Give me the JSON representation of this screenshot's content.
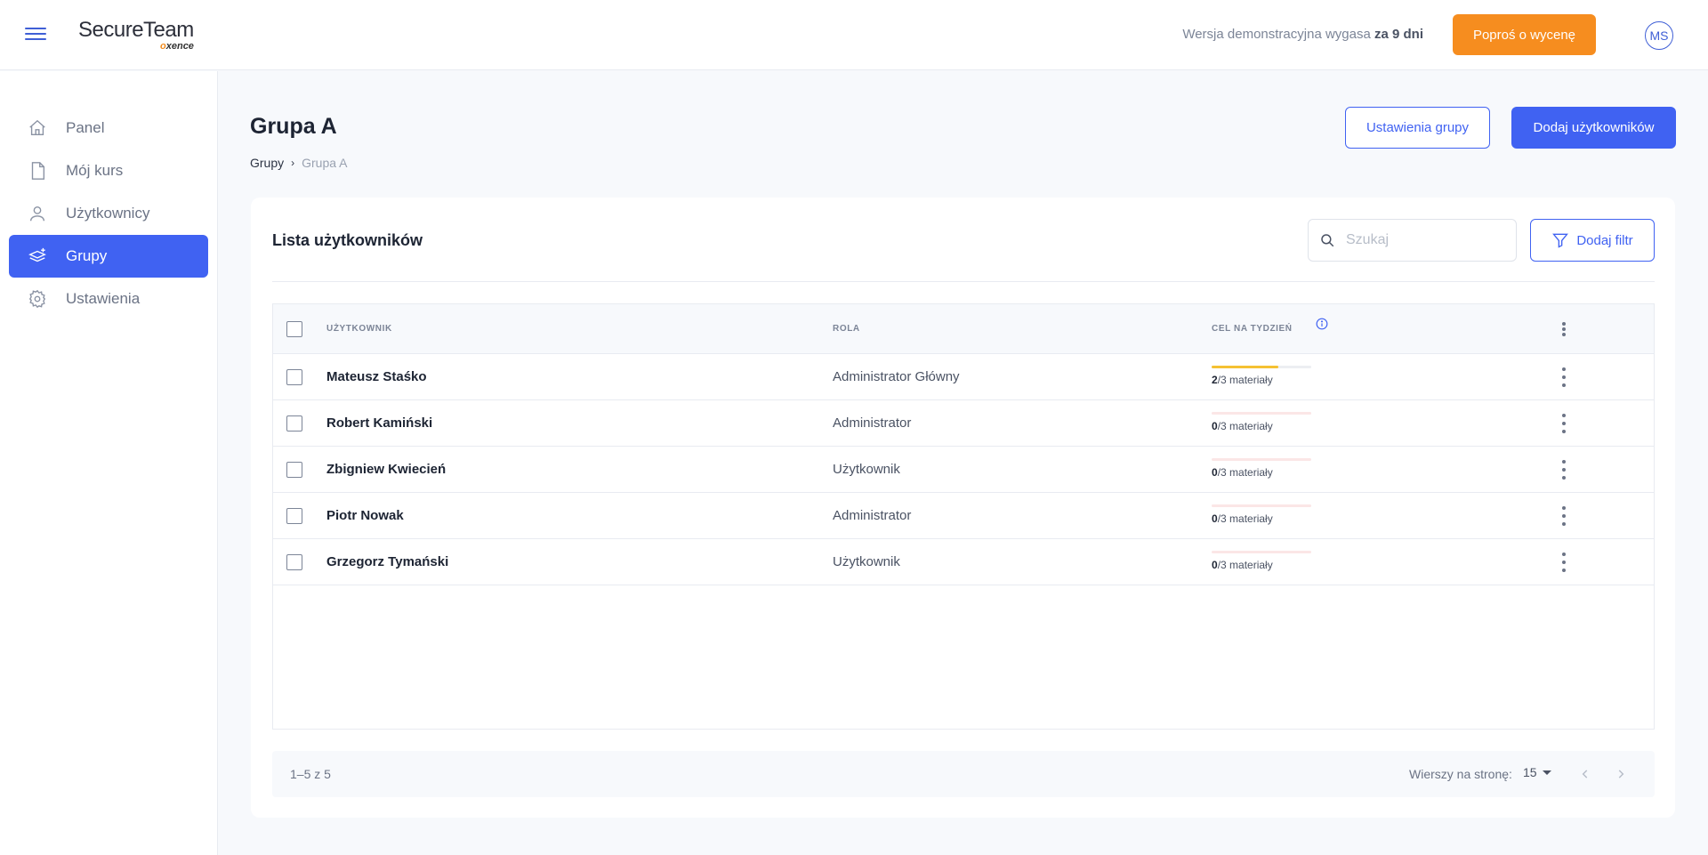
{
  "header": {
    "logo_main": "SecureTeam",
    "logo_sub_prefix": "o",
    "logo_sub_rest": "xence",
    "trial_text": "Wersja demonstracyjna wygasa",
    "trial_bold": "za 9 dni",
    "quote_button": "Poproś o wycenę",
    "avatar_initials": "MS",
    "accent_color": "#4062f2",
    "orange_color": "#f68d1f"
  },
  "sidebar": {
    "items": [
      {
        "label": "Panel",
        "icon": "home-icon",
        "active": false
      },
      {
        "label": "Mój kurs",
        "icon": "document-icon",
        "active": false
      },
      {
        "label": "Użytkownicy",
        "icon": "user-icon",
        "active": false
      },
      {
        "label": "Grupy",
        "icon": "layers-icon",
        "active": true
      },
      {
        "label": "Ustawienia",
        "icon": "gear-icon",
        "active": false
      }
    ]
  },
  "page": {
    "title": "Grupa A",
    "breadcrumb": [
      "Grupy",
      "Grupa A"
    ],
    "settings_button": "Ustawienia grupy",
    "add_users_button": "Dodaj użytkowników"
  },
  "list": {
    "title": "Lista użytkowników",
    "search_placeholder": "Szukaj",
    "filter_button": "Dodaj filtr",
    "columns": [
      "Użytkownik",
      "Rola",
      "Cel na tydzień"
    ],
    "rows": [
      {
        "name": "Mateusz Staśko",
        "role": "Administrator Główny",
        "done": "2",
        "total_label": "/3 materiały",
        "progress": 0.667
      },
      {
        "name": "Robert Kamiński",
        "role": "Administrator",
        "done": "0",
        "total_label": "/3 materiały",
        "progress": 0
      },
      {
        "name": "Zbigniew Kwiecień",
        "role": "Użytkownik",
        "done": "0",
        "total_label": "/3 materiały",
        "progress": 0
      },
      {
        "name": "Piotr Nowak",
        "role": "Administrator",
        "done": "0",
        "total_label": "/3 materiały",
        "progress": 0
      },
      {
        "name": "Grzegorz Tymański",
        "role": "Użytkownik",
        "done": "0",
        "total_label": "/3 materiały",
        "progress": 0
      }
    ]
  },
  "pagination": {
    "range": "1–5 z 5",
    "rows_per_page_label": "Wierszy na stronę:",
    "rows_per_page_value": "15"
  }
}
